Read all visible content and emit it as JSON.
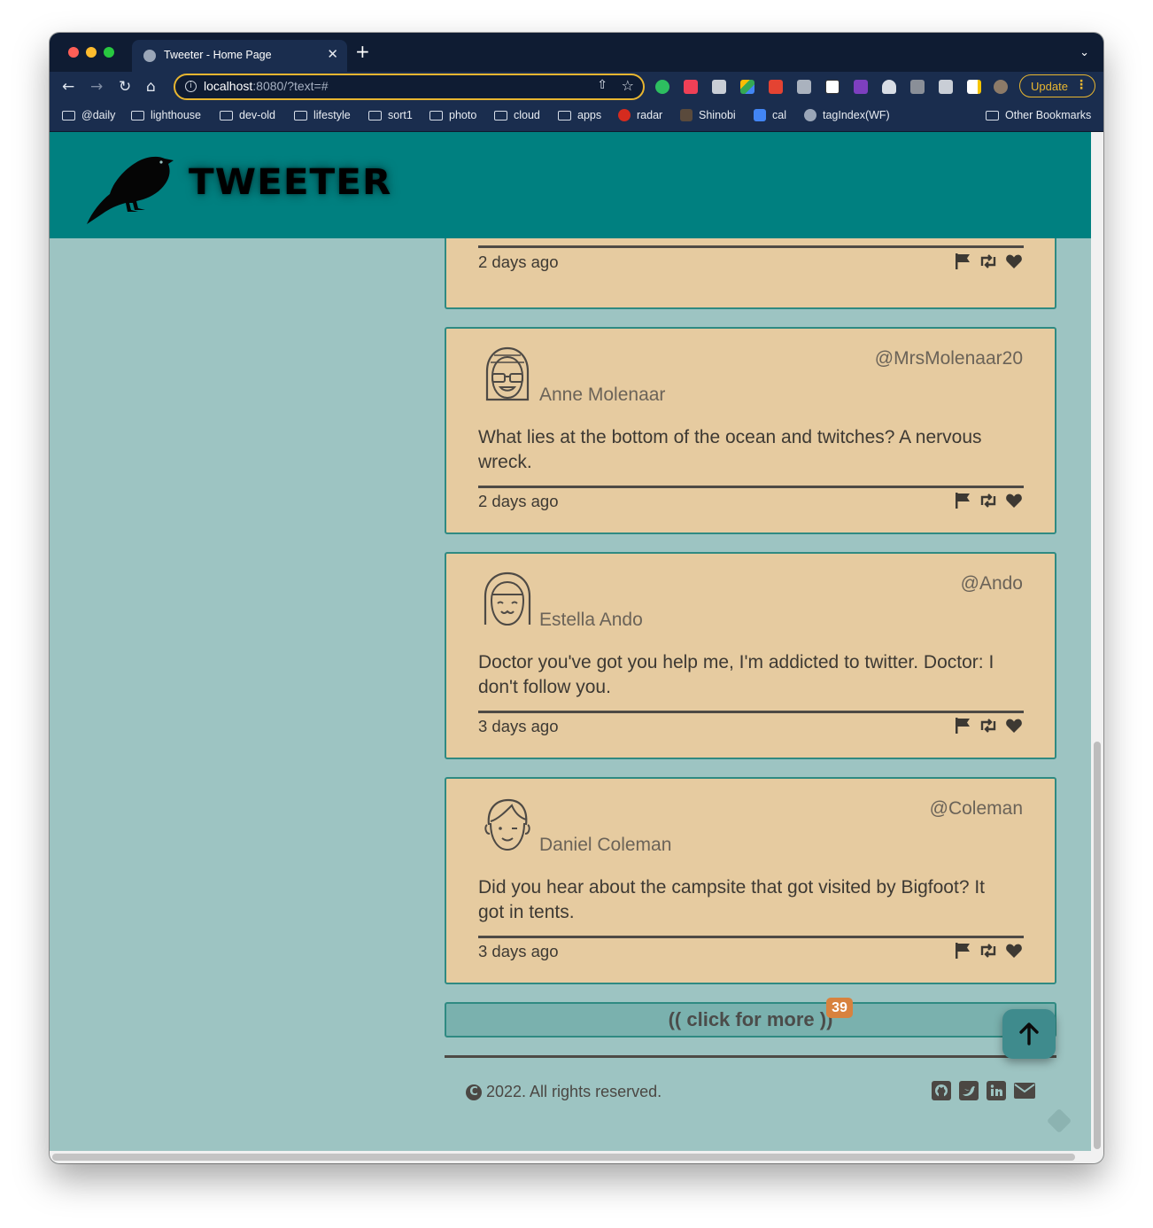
{
  "browser": {
    "tab_title": "Tweeter - Home Page",
    "url_host": "localhost",
    "url_rest": ":8080/?text=#",
    "update_label": "Update",
    "bookmarks": [
      {
        "label": "@daily",
        "type": "folder"
      },
      {
        "label": "lighthouse",
        "type": "folder"
      },
      {
        "label": "dev-old",
        "type": "folder"
      },
      {
        "label": "lifestyle",
        "type": "folder"
      },
      {
        "label": "sort1",
        "type": "folder"
      },
      {
        "label": "photo",
        "type": "folder"
      },
      {
        "label": "cloud",
        "type": "folder"
      },
      {
        "label": "apps",
        "type": "folder"
      },
      {
        "label": "radar",
        "type": "site",
        "icon": "maple-leaf-icon"
      },
      {
        "label": "Shinobi",
        "type": "site",
        "icon": "ninja-icon"
      },
      {
        "label": "cal",
        "type": "site",
        "icon": "calendar-icon"
      },
      {
        "label": "tagIndex(WF)",
        "type": "site",
        "icon": "globe-icon"
      }
    ],
    "other_bookmarks": "Other Bookmarks"
  },
  "header": {
    "brand": "TWEETER"
  },
  "tweets": [
    {
      "handle": "@MrsMolenaar20",
      "name": "Anne Molenaar",
      "content": "What lies at the bottom of the ocean and twitches? A nervous wreck.",
      "date": "2 days ago"
    },
    {
      "handle": "@Ando",
      "name": "Estella Ando",
      "content": "Doctor you've got you help me, I'm addicted to twitter. Doctor: I don't follow you.",
      "date": "3 days ago"
    },
    {
      "handle": "@Coleman",
      "name": "Daniel Coleman",
      "content": "Did you hear about the campsite that got visited by Bigfoot? It got in tents.",
      "date": "3 days ago"
    }
  ],
  "partial_tweet": {
    "date": "2 days ago"
  },
  "more": {
    "label": "(( click for more ))",
    "count": "39"
  },
  "footer": {
    "copyright": "2022. All rights reserved.",
    "copy_symbol": "C",
    "socials": [
      "github-icon",
      "twitter-icon",
      "linkedin-icon",
      "mail-icon"
    ]
  },
  "colors": {
    "header": "#008080",
    "page_bg": "#9dc4c2",
    "tweet_bg": "#e6cba0",
    "tweet_border": "#2f8a82",
    "badge": "#d8823e"
  }
}
